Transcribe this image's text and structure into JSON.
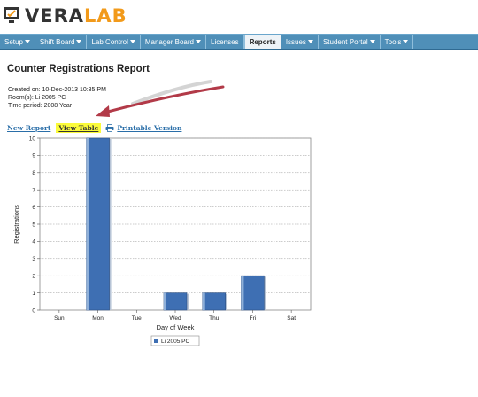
{
  "app": {
    "logo_text_main": "VERA",
    "logo_text_accent": "LAB"
  },
  "nav": {
    "items": [
      {
        "label": "Setup",
        "dropdown": true
      },
      {
        "label": "Shift Board",
        "dropdown": true
      },
      {
        "label": "Lab Control",
        "dropdown": true
      },
      {
        "label": "Manager Board",
        "dropdown": true
      },
      {
        "label": "Licenses",
        "dropdown": false
      },
      {
        "label": "Reports",
        "dropdown": false,
        "active": true
      },
      {
        "label": "Issues",
        "dropdown": true
      },
      {
        "label": "Student Portal",
        "dropdown": true
      },
      {
        "label": "Tools",
        "dropdown": true
      }
    ]
  },
  "report": {
    "title": "Counter Registrations Report",
    "created_on": "Created on: 10-Dec-2013 10:35 PM",
    "rooms": "Room(s): Li 2005 PC",
    "time_period": "Time period: 2008 Year"
  },
  "links": {
    "new_report": "New Report",
    "view_table": "View Table",
    "printable_version": "Printable Version",
    "print_icon": "printer-icon"
  },
  "colors": {
    "nav_bg": "#4f8fb8",
    "bar_fill": "#3e6fb3",
    "highlight": "#fbfb3a",
    "link": "#2a6ea8",
    "annotation_arrow": "#b23a48",
    "logo_accent": "#f29a1a"
  },
  "chart_data": {
    "type": "bar",
    "categories": [
      "Sun",
      "Mon",
      "Tue",
      "Wed",
      "Thu",
      "Fri",
      "Sat"
    ],
    "series": [
      {
        "name": "Li 2005 PC",
        "values": [
          0,
          10,
          0,
          1,
          1,
          2,
          0
        ]
      }
    ],
    "xlabel": "Day of Week",
    "ylabel": "Registrations",
    "ylim": [
      0,
      10
    ],
    "yticks": [
      0,
      1,
      2,
      3,
      4,
      5,
      6,
      7,
      8,
      9,
      10
    ],
    "grid": true,
    "legend": "bottom-center"
  }
}
